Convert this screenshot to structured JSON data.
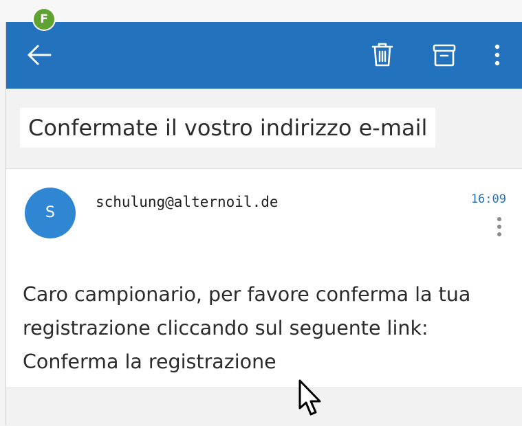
{
  "badge": {
    "letter": "F",
    "color": "#5ea332"
  },
  "appbar": {
    "color": "#2272bd",
    "icons": {
      "back": "arrow-left-icon",
      "delete": "trash-icon",
      "archive": "archive-icon",
      "more": "more-vertical-icon"
    }
  },
  "email": {
    "subject": "Confermate il vostro indirizzo e-mail",
    "sender": {
      "initial": "S",
      "address": "schulung@alternoil.de",
      "avatar_color": "#2f86d2"
    },
    "time": "16:09",
    "body": {
      "line1": "Caro campionario, per favore conferma la tua",
      "line2": "registrazione cliccando sul seguente link:",
      "link": "Conferma la registrazione"
    }
  }
}
